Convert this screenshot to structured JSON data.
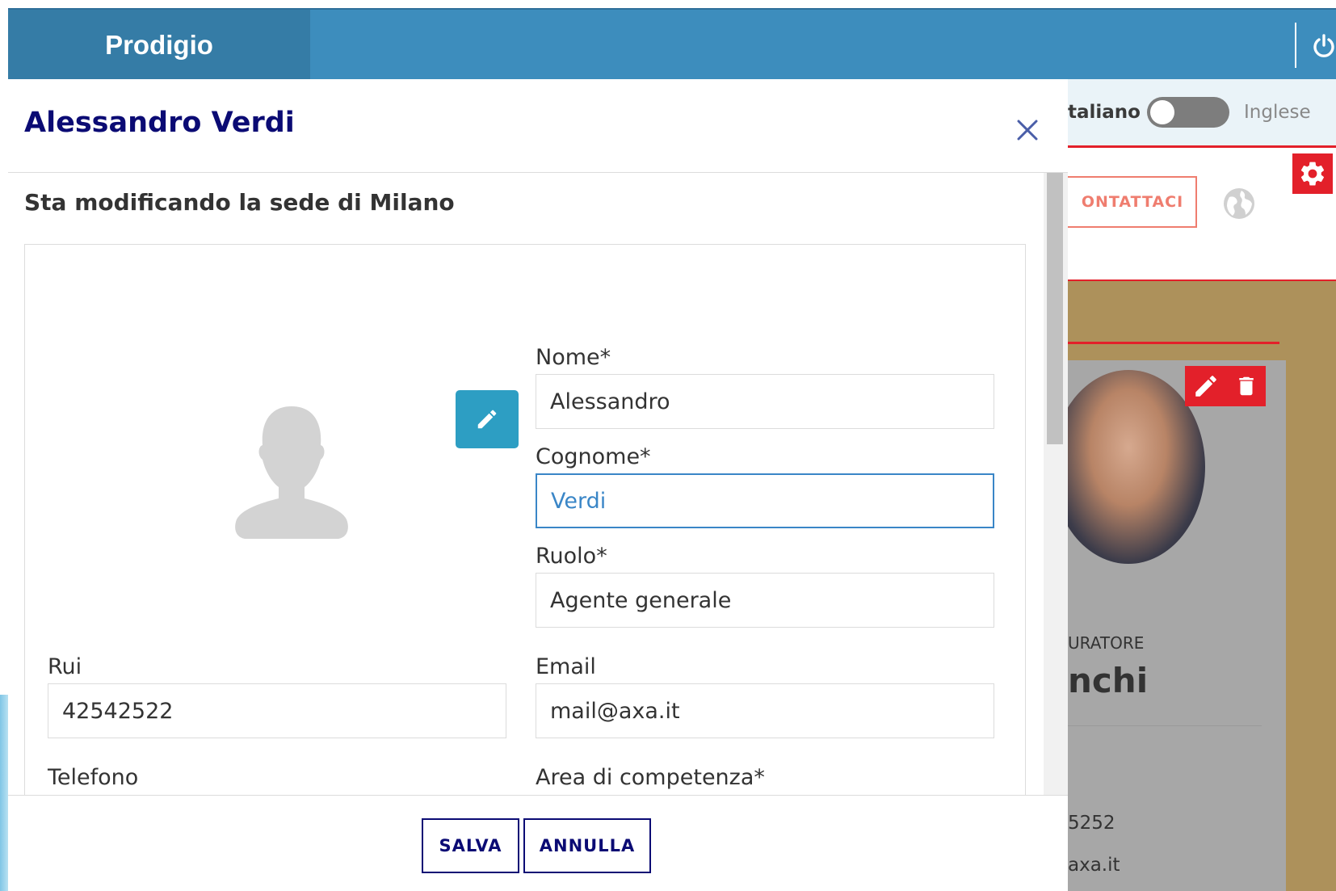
{
  "app": {
    "brand": "Prodigio"
  },
  "background_page": {
    "lang_left": "taliano",
    "lang_right": "Inglese",
    "contact_button": "ONTATTACI",
    "card_role": "URATORE",
    "card_name": "nchi",
    "card_phone": "5252",
    "card_email": "axa.it"
  },
  "modal": {
    "title": "Alessandro Verdi",
    "subtitle": "Sta modificando la sede di Milano",
    "fields": {
      "nome": {
        "label": "Nome*",
        "value": "Alessandro"
      },
      "cognome": {
        "label": "Cognome*",
        "value": "Verdi"
      },
      "ruolo": {
        "label": "Ruolo*",
        "value": "Agente generale"
      },
      "rui": {
        "label": "Rui",
        "value": "42542522"
      },
      "email": {
        "label": "Email",
        "value": "mail@axa.it"
      },
      "telefono": {
        "label": "Telefono"
      },
      "area": {
        "label": "Area di competenza*"
      }
    },
    "buttons": {
      "save": "SALVA",
      "cancel": "ANNULLA"
    }
  },
  "icons": {
    "power": "power-icon",
    "close": "close-icon",
    "edit": "pencil-icon",
    "avatar": "user-silhouette-icon",
    "gear": "gear-icon",
    "globe": "globe-icon",
    "trash": "trash-icon"
  },
  "colors": {
    "topbar": "#3d8dbd",
    "brand_bg": "#357ca6",
    "title": "#0b0b74",
    "accent_red": "#e3202a",
    "edit_button": "#2d9ec3",
    "focus_border": "#3a86c7"
  }
}
